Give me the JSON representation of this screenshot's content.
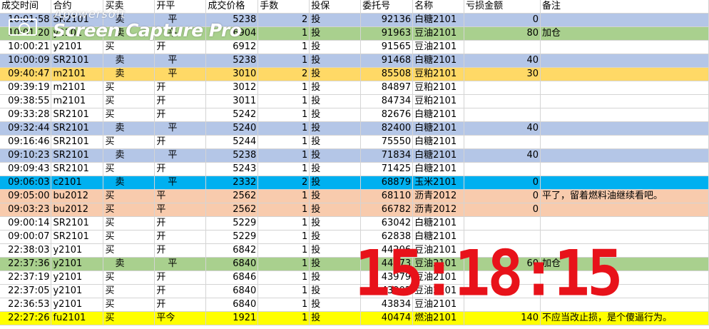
{
  "columns": [
    "成交时间",
    "合约",
    "买卖",
    "开平",
    "成交价格",
    "手数",
    "投保",
    "委托号",
    "名称",
    "亏损金额",
    "备注"
  ],
  "rows": [
    {
      "time": "10:01:58",
      "contract": "SR2101",
      "side": "卖",
      "oc": "平",
      "price": "5238",
      "qty": "2",
      "hedge": "投",
      "order": "92136",
      "name": "白糖2101",
      "loss": "0",
      "note": "",
      "style": "blue"
    },
    {
      "time": "10:01:20",
      "contract": "y2101",
      "side": "卖",
      "oc": "平",
      "price": "6904",
      "qty": "1",
      "hedge": "投",
      "order": "91963",
      "name": "豆油2101",
      "loss": "80",
      "note": "加仓",
      "style": "green"
    },
    {
      "time": "10:00:21",
      "contract": "y2101",
      "side": "买",
      "oc": "开",
      "price": "6912",
      "qty": "1",
      "hedge": "投",
      "order": "91565",
      "name": "豆油2101",
      "loss": "",
      "note": "",
      "style": ""
    },
    {
      "time": "10:00:09",
      "contract": "SR2101",
      "side": "卖",
      "oc": "平",
      "price": "5238",
      "qty": "1",
      "hedge": "投",
      "order": "91468",
      "name": "白糖2101",
      "loss": "40",
      "note": "",
      "style": "blue"
    },
    {
      "time": "09:40:47",
      "contract": "m2101",
      "side": "卖",
      "oc": "平",
      "price": "3010",
      "qty": "2",
      "hedge": "投",
      "order": "85508",
      "name": "豆粕2101",
      "loss": "30",
      "note": "",
      "style": "orange"
    },
    {
      "time": "09:39:19",
      "contract": "m2101",
      "side": "买",
      "oc": "开",
      "price": "3012",
      "qty": "1",
      "hedge": "投",
      "order": "84897",
      "name": "豆粕2101",
      "loss": "",
      "note": "",
      "style": ""
    },
    {
      "time": "09:38:55",
      "contract": "m2101",
      "side": "买",
      "oc": "开",
      "price": "3011",
      "qty": "1",
      "hedge": "投",
      "order": "84734",
      "name": "豆粕2101",
      "loss": "",
      "note": "",
      "style": ""
    },
    {
      "time": "09:33:28",
      "contract": "SR2101",
      "side": "买",
      "oc": "开",
      "price": "5242",
      "qty": "1",
      "hedge": "投",
      "order": "82676",
      "name": "白糖2101",
      "loss": "",
      "note": "",
      "style": ""
    },
    {
      "time": "09:32:44",
      "contract": "SR2101",
      "side": "卖",
      "oc": "平",
      "price": "5240",
      "qty": "1",
      "hedge": "投",
      "order": "82400",
      "name": "白糖2101",
      "loss": "40",
      "note": "",
      "style": "blue"
    },
    {
      "time": "09:16:46",
      "contract": "SR2101",
      "side": "买",
      "oc": "开",
      "price": "5244",
      "qty": "1",
      "hedge": "投",
      "order": "75550",
      "name": "白糖2101",
      "loss": "",
      "note": "",
      "style": ""
    },
    {
      "time": "09:10:23",
      "contract": "SR2101",
      "side": "卖",
      "oc": "平",
      "price": "5238",
      "qty": "1",
      "hedge": "投",
      "order": "71834",
      "name": "白糖2101",
      "loss": "40",
      "note": "",
      "style": "blue"
    },
    {
      "time": "09:09:43",
      "contract": "SR2101",
      "side": "买",
      "oc": "开",
      "price": "5243",
      "qty": "1",
      "hedge": "投",
      "order": "71425",
      "name": "白糖2101",
      "loss": "",
      "note": "",
      "style": ""
    },
    {
      "time": "09:06:03",
      "contract": "c2101",
      "side": "卖",
      "oc": "平",
      "price": "2332",
      "qty": "2",
      "hedge": "投",
      "order": "68879",
      "name": "玉米2101",
      "loss": "0",
      "note": "",
      "style": "cyan"
    },
    {
      "time": "09:05:00",
      "contract": "bu2012",
      "side": "买",
      "oc": "平",
      "price": "2562",
      "qty": "1",
      "hedge": "投",
      "order": "68110",
      "name": "沥青2012",
      "loss": "0",
      "note": "平了，留着燃料油继续看吧。",
      "style": "peach"
    },
    {
      "time": "09:03:23",
      "contract": "bu2012",
      "side": "买",
      "oc": "平",
      "price": "2562",
      "qty": "1",
      "hedge": "投",
      "order": "66782",
      "name": "沥青2012",
      "loss": "0",
      "note": "",
      "style": "peach"
    },
    {
      "time": "09:00:14",
      "contract": "SR2101",
      "side": "买",
      "oc": "开",
      "price": "5229",
      "qty": "1",
      "hedge": "投",
      "order": "63042",
      "name": "白糖2101",
      "loss": "",
      "note": "",
      "style": ""
    },
    {
      "time": "09:00:07",
      "contract": "SR2101",
      "side": "买",
      "oc": "开",
      "price": "5229",
      "qty": "1",
      "hedge": "投",
      "order": "62838",
      "name": "白糖2101",
      "loss": "",
      "note": "",
      "style": ""
    },
    {
      "time": "22:38:03",
      "contract": "y2101",
      "side": "买",
      "oc": "开",
      "price": "6842",
      "qty": "1",
      "hedge": "投",
      "order": "44206",
      "name": "豆油2101",
      "loss": "",
      "note": "",
      "style": ""
    },
    {
      "time": "22:37:36",
      "contract": "y2101",
      "side": "卖",
      "oc": "平",
      "price": "6840",
      "qty": "1",
      "hedge": "投",
      "order": "44073",
      "name": "豆油2101",
      "loss": "60",
      "note": "加仓",
      "style": "green"
    },
    {
      "time": "22:37:19",
      "contract": "y2101",
      "side": "买",
      "oc": "开",
      "price": "6846",
      "qty": "1",
      "hedge": "投",
      "order": "43979",
      "name": "豆油2101",
      "loss": "",
      "note": "",
      "style": ""
    },
    {
      "time": "22:37:05",
      "contract": "y2101",
      "side": "买",
      "oc": "开",
      "price": "6840",
      "qty": "1",
      "hedge": "投",
      "order": "43902",
      "name": "豆油2101",
      "loss": "",
      "note": "",
      "style": ""
    },
    {
      "time": "22:36:53",
      "contract": "y2101",
      "side": "买",
      "oc": "开",
      "price": "6840",
      "qty": "1",
      "hedge": "投",
      "order": "43834",
      "name": "豆油2101",
      "loss": "",
      "note": "",
      "style": ""
    },
    {
      "time": "22:27:26",
      "contract": "fu2101",
      "side": "买",
      "oc": "平今",
      "price": "1921",
      "qty": "1",
      "hedge": "投",
      "order": "40474",
      "name": "燃油2101",
      "loss": "140",
      "note": "不应当改止损，是个傻逼行为。",
      "style": "yellow"
    }
  ],
  "watermark": {
    "brand": "Apowersoft",
    "product": "Screen Capture Pro"
  },
  "clock": "15:18:15"
}
